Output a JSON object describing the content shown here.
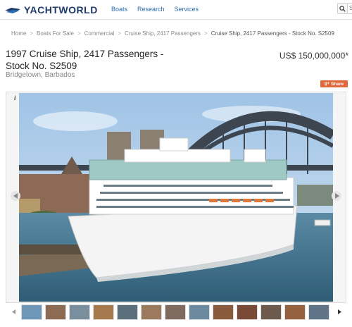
{
  "header": {
    "logo_text": "YACHTWORLD",
    "nav": [
      "Boats",
      "Research",
      "Services"
    ],
    "search_text": "S"
  },
  "breadcrumb": [
    "Home",
    "Boats For Sale",
    "Commercial",
    "Cruise Ship, 2417 Passengers",
    "Cruise Ship, 2417 Passengers - Stock No. S2509"
  ],
  "listing": {
    "title": "1997 Cruise Ship, 2417 Passengers - Stock No. S2509",
    "location": "Bridgetown, Barbados",
    "price": "US$ 150,000,000*",
    "share_label": "Share",
    "share_icon": "g+"
  },
  "gallery": {
    "info_label": "i",
    "photo_icon": "cruise-ship-harbour-photo",
    "thumbnail_count": 13
  },
  "colors": {
    "brand": "#1f3a6a",
    "link": "#2a6db0",
    "share": "#e0673b"
  }
}
